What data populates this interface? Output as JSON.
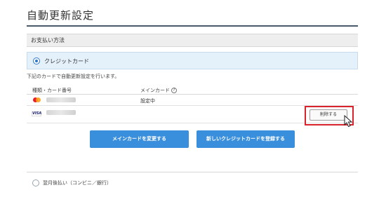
{
  "page": {
    "title": "自動更新設定"
  },
  "payment": {
    "section_label": "お支払い方法",
    "credit_card_option": {
      "label": "クレジットカード",
      "selected": true
    },
    "description": "下記のカードで自動更新設定を行います。",
    "table": {
      "columns": [
        "種類・カード番号",
        "メインカード"
      ],
      "help_icon": "?",
      "rows": [
        {
          "brand": "mastercard-icon",
          "status": "設定中"
        },
        {
          "brand": "visa-icon",
          "brand_text": "VISA",
          "action_label": "削除する"
        }
      ]
    },
    "buttons": {
      "change_main_card": "メインカードを変更する",
      "register_new_card": "新しいクレジットカードを登録する"
    },
    "later_option": {
      "label": "翌月後払い（コンビニ／銀行）",
      "selected": false
    }
  },
  "colors": {
    "accent_blue": "#3a8fdc",
    "highlight_red": "#d9232a"
  }
}
